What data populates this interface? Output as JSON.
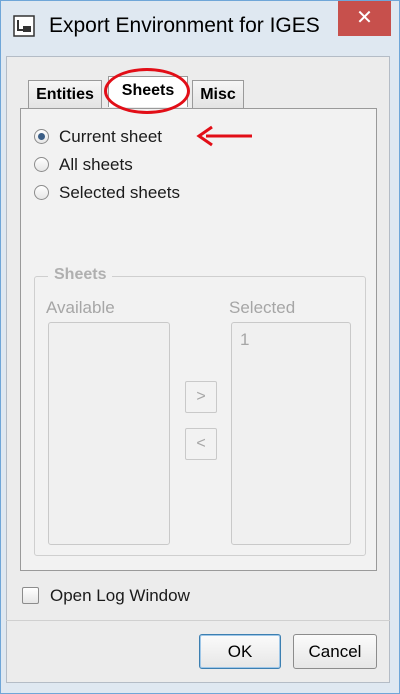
{
  "window": {
    "title": "Export Environment for IGES",
    "close_label": "✕"
  },
  "tabs": [
    {
      "label": "Entities",
      "active": false
    },
    {
      "label": "Sheets",
      "active": true
    },
    {
      "label": "Misc",
      "active": false
    }
  ],
  "sheets_options": [
    {
      "label": "Current sheet",
      "checked": true
    },
    {
      "label": "All sheets",
      "checked": false
    },
    {
      "label": "Selected sheets",
      "checked": false
    }
  ],
  "sheets_group": {
    "title": "Sheets",
    "available_label": "Available",
    "available_items": [],
    "selected_label": "Selected",
    "selected_items": [
      "1"
    ],
    "add_button": ">",
    "remove_button": "<"
  },
  "open_log": {
    "label": "Open Log Window",
    "checked": false
  },
  "buttons": {
    "ok": "OK",
    "cancel": "Cancel"
  },
  "colors": {
    "highlight": "#e20e17",
    "title_bar": "#dfe8f1",
    "close_button": "#c7504c"
  }
}
